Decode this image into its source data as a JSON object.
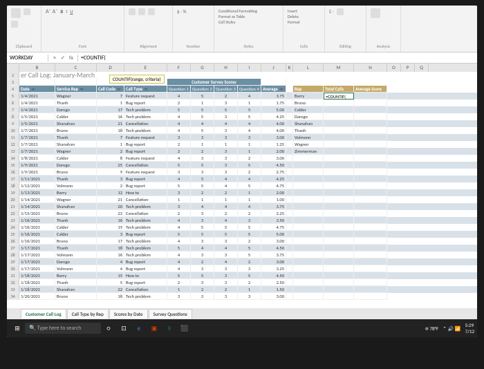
{
  "ribbon": {
    "groups": [
      "Clipboard",
      "Font",
      "Alignment",
      "Number",
      "Styles",
      "Cells",
      "Editing",
      "Analysis"
    ],
    "cond_format": "Conditional Formatting",
    "format_table": "Format as Table",
    "cell_styles": "Cell Styles",
    "insert": "Insert",
    "delete": "Delete",
    "format": "Format"
  },
  "namebox": "WORKDAY",
  "fx_btns": {
    "cancel": "×",
    "enter": "✓",
    "fx": "fx"
  },
  "formula": "=COUNTIF(",
  "tooltip": "COUNTIF(range, criteria)",
  "cols": [
    "B",
    "C",
    "D",
    "E",
    "F",
    "G",
    "H",
    "I",
    "J",
    "K",
    "L",
    "M",
    "N",
    "O",
    "P",
    "Q"
  ],
  "title": "er Call Log: January-March",
  "cs_header": "Customer Survey Scores",
  "q_labels": {
    "q": "Question",
    "n1": "1",
    "n2": "2",
    "n3": "3",
    "n4": "4"
  },
  "headers": {
    "date": "Date",
    "rep": "Service Rep",
    "code": "Call Code",
    "type": "Call Type",
    "avg": "Average",
    "side_rep": "Rep",
    "side_total": "Total Calls",
    "side_avg": "Average Score"
  },
  "side": {
    "formula": "=COUNTIF(",
    "reps": [
      "Barry",
      "Bruno",
      "Calder",
      "Darego",
      "Shanahan",
      "Thanh",
      "Volmann",
      "Wagner",
      "Zimmerman"
    ]
  },
  "rows": [
    {
      "n": 5,
      "d": "1/4/2021",
      "rep": "Wagner",
      "code": "7",
      "type": "Feature request",
      "q": [
        4,
        5,
        2,
        4
      ],
      "avg": "3.75",
      "alt": 1
    },
    {
      "n": 6,
      "d": "1/4/2021",
      "rep": "Thanh",
      "code": "1",
      "type": "Bug report",
      "q": [
        2,
        1,
        3,
        1
      ],
      "avg": "1.75"
    },
    {
      "n": 7,
      "d": "1/4/2021",
      "rep": "Darego",
      "code": "17",
      "type": "Tech problem",
      "q": [
        5,
        5,
        5,
        5
      ],
      "avg": "5.00",
      "alt": 1
    },
    {
      "n": 8,
      "d": "1/5/2021",
      "rep": "Calder",
      "code": "16",
      "type": "Tech problem",
      "q": [
        4,
        5,
        3,
        5
      ],
      "avg": "4.25"
    },
    {
      "n": 9,
      "d": "1/5/2021",
      "rep": "Shanahan",
      "code": "21",
      "type": "Cancellation",
      "q": [
        4,
        4,
        4,
        4
      ],
      "avg": "4.00",
      "alt": 1
    },
    {
      "n": 10,
      "d": "1/7/2021",
      "rep": "Bruno",
      "code": "18",
      "type": "Tech problem",
      "q": [
        4,
        5,
        3,
        4
      ],
      "avg": "4.00"
    },
    {
      "n": 11,
      "d": "1/7/2021",
      "rep": "Thanh",
      "code": "7",
      "type": "Feature request",
      "q": [
        3,
        3,
        3,
        3
      ],
      "avg": "3.00",
      "alt": 1
    },
    {
      "n": 12,
      "d": "1/7/2021",
      "rep": "Shanahan",
      "code": "1",
      "type": "Bug report",
      "q": [
        2,
        1,
        1,
        1
      ],
      "avg": "1.25"
    },
    {
      "n": 13,
      "d": "1/7/2021",
      "rep": "Wagner",
      "code": "2",
      "type": "Bug report",
      "q": [
        2,
        2,
        3,
        1
      ],
      "avg": "2.00",
      "alt": 1
    },
    {
      "n": 14,
      "d": "1/8/2021",
      "rep": "Calder",
      "code": "8",
      "type": "Feature request",
      "q": [
        4,
        3,
        3,
        2
      ],
      "avg": "3.00"
    },
    {
      "n": 15,
      "d": "1/9/2021",
      "rep": "Darego",
      "code": "25",
      "type": "Cancellation",
      "q": [
        5,
        5,
        3,
        5
      ],
      "avg": "4.50",
      "alt": 1
    },
    {
      "n": 16,
      "d": "1/9/2021",
      "rep": "Bruno",
      "code": "9",
      "type": "Feature request",
      "q": [
        3,
        3,
        3,
        2
      ],
      "avg": "2.75"
    },
    {
      "n": 17,
      "d": "1/11/2021",
      "rep": "Thanh",
      "code": "3",
      "type": "Bug report",
      "q": [
        4,
        5,
        4,
        4
      ],
      "avg": "4.25",
      "alt": 1
    },
    {
      "n": 18,
      "d": "1/12/2021",
      "rep": "Volmann",
      "code": "2",
      "type": "Bug report",
      "q": [
        5,
        5,
        4,
        5
      ],
      "avg": "4.75"
    },
    {
      "n": 19,
      "d": "1/13/2021",
      "rep": "Barry",
      "code": "12",
      "type": "How to",
      "q": [
        3,
        2,
        2,
        1
      ],
      "avg": "2.00",
      "alt": 1
    },
    {
      "n": 20,
      "d": "1/14/2021",
      "rep": "Wagner",
      "code": "21",
      "type": "Cancellation",
      "q": [
        1,
        1,
        1,
        1
      ],
      "avg": "1.00"
    },
    {
      "n": 21,
      "d": "1/14/2021",
      "rep": "Shanahan",
      "code": "20",
      "type": "Tech problem",
      "q": [
        3,
        4,
        4,
        4
      ],
      "avg": "3.75",
      "alt": 1
    },
    {
      "n": 22,
      "d": "1/15/2021",
      "rep": "Bruno",
      "code": "22",
      "type": "Cancellation",
      "q": [
        2,
        3,
        2,
        2
      ],
      "avg": "2.25"
    },
    {
      "n": 23,
      "d": "1/16/2021",
      "rep": "Thanh",
      "code": "16",
      "type": "Tech problem",
      "q": [
        4,
        3,
        4,
        3
      ],
      "avg": "3.50",
      "alt": 1
    },
    {
      "n": 24,
      "d": "1/16/2021",
      "rep": "Calder",
      "code": "19",
      "type": "Tech problem",
      "q": [
        4,
        5,
        5,
        5
      ],
      "avg": "4.75"
    },
    {
      "n": 25,
      "d": "1/16/2021",
      "rep": "Calder",
      "code": "3",
      "type": "Bug report",
      "q": [
        5,
        5,
        5,
        5
      ],
      "avg": "5.00",
      "alt": 1
    },
    {
      "n": 26,
      "d": "1/16/2021",
      "rep": "Bruno",
      "code": "17",
      "type": "Tech problem",
      "q": [
        4,
        3,
        3,
        2
      ],
      "avg": "3.00"
    },
    {
      "n": 27,
      "d": "1/17/2021",
      "rep": "Thanh",
      "code": "18",
      "type": "Tech problem",
      "q": [
        5,
        4,
        4,
        5
      ],
      "avg": "4.50",
      "alt": 1
    },
    {
      "n": 28,
      "d": "1/17/2021",
      "rep": "Volmann",
      "code": "16",
      "type": "Tech problem",
      "q": [
        4,
        3,
        3,
        5
      ],
      "avg": "3.75"
    },
    {
      "n": 29,
      "d": "1/17/2021",
      "rep": "Darego",
      "code": "4",
      "type": "Bug report",
      "q": [
        4,
        2,
        4,
        2
      ],
      "avg": "3.00",
      "alt": 1
    },
    {
      "n": 30,
      "d": "1/17/2021",
      "rep": "Volmann",
      "code": "4",
      "type": "Bug report",
      "q": [
        4,
        3,
        3,
        3
      ],
      "avg": "3.25"
    },
    {
      "n": 31,
      "d": "1/18/2021",
      "rep": "Barry",
      "code": "15",
      "type": "How to",
      "q": [
        5,
        5,
        3,
        5
      ],
      "avg": "4.50",
      "alt": 1
    },
    {
      "n": 32,
      "d": "1/18/2021",
      "rep": "Thanh",
      "code": "5",
      "type": "Bug report",
      "q": [
        2,
        3,
        3,
        2
      ],
      "avg": "2.50"
    },
    {
      "n": 33,
      "d": "1/18/2021",
      "rep": "Shanahan",
      "code": "22",
      "type": "Cancellation",
      "q": [
        1,
        2,
        2,
        1
      ],
      "avg": "1.50",
      "alt": 1
    },
    {
      "n": 34,
      "d": "1/20/2021",
      "rep": "Bruno",
      "code": "18",
      "type": "Tech problem",
      "q": [
        3,
        3,
        3,
        3
      ],
      "avg": "3.00"
    }
  ],
  "tabs": [
    "Customer Call Log",
    "Call Type by Rep",
    "Scores by Date",
    "Survey Questions"
  ],
  "taskbar": {
    "search": "Type here to search",
    "temp": "78°F",
    "time": "5:29",
    "date": "7/12"
  }
}
